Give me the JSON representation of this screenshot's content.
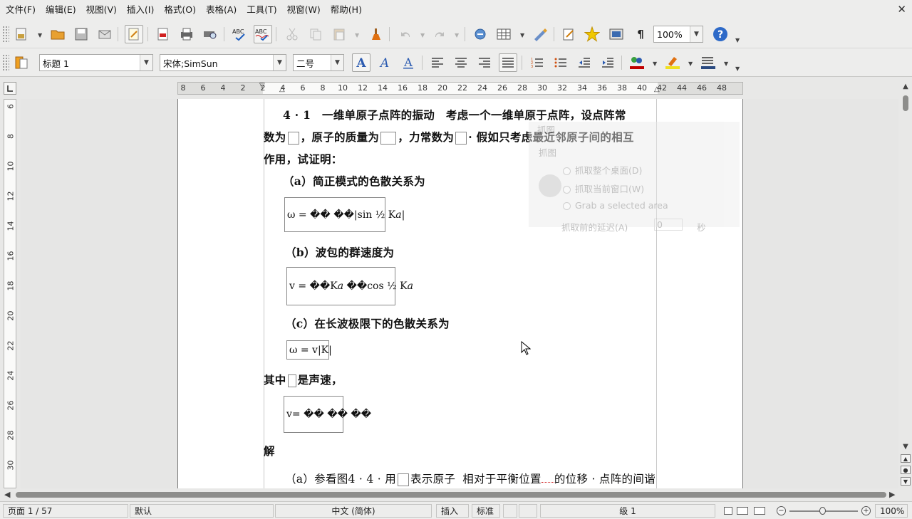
{
  "menubar": {
    "items": [
      "文件(F)",
      "编辑(E)",
      "视图(V)",
      "插入(I)",
      "格式(O)",
      "表格(A)",
      "工具(T)",
      "视窗(W)",
      "帮助(H)"
    ],
    "close_glyph": "✕"
  },
  "toolbar_standard": {
    "zoom_value": "100%",
    "formatting_marks_glyph": "¶",
    "help_glyph": "?"
  },
  "toolbar_format": {
    "paragraph_style": "标题 1",
    "font_name": "宋体;SimSun",
    "font_size": "二号"
  },
  "ruler": {
    "horizontal_ticks": [
      "8",
      "6",
      "4",
      "2",
      "2",
      "4",
      "6",
      "8",
      "10",
      "12",
      "14",
      "16",
      "18",
      "20",
      "22",
      "24",
      "26",
      "28",
      "30",
      "32",
      "34",
      "36",
      "38",
      "40",
      "42",
      "44",
      "46",
      "48"
    ],
    "vertical_ticks": [
      "6",
      "8",
      "10",
      "12",
      "14",
      "16",
      "18",
      "20",
      "22",
      "24",
      "26",
      "28",
      "30"
    ]
  },
  "document": {
    "lines": [
      "4 · 1　一维单原子点阵的振动　考虑一个一维单原于点阵，设点阵常",
      "数为",
      "，原子的质量为",
      "，力常数为",
      "· 假如只考虑最近邻原子间的相互",
      "作用，试证明：",
      "（a）简正模式的色散关系为",
      "（b）波包的群速度为",
      "（c）在长波极限下的色散关系为",
      "其中",
      "是声速，",
      "解",
      "（a）参看图4 · 4 · 用",
      "表示原子",
      "相对于平衡位置",
      "的位移 · 点阵的间谐"
    ],
    "formulas": {
      "a": "ω = �� ��|sin ½ K𝑎|",
      "b": "v = ��K𝑎 ��cos ½ K𝑎",
      "c": "ω = v|K|",
      "d": "v= �� �� ��"
    }
  },
  "grab_dialog_ghost": {
    "title": "抓图",
    "section": "抓图",
    "options": [
      "抓取整个桌面(D)",
      "抓取当前窗口(W)",
      "Grab a selected area"
    ],
    "delay_label": "抓取前的延迟(A)",
    "delay_value": "0",
    "unit": "秒"
  },
  "statusbar": {
    "page": "页面 1 / 57",
    "page_style": "默认",
    "language": "中文 (简体)",
    "insert_mode": "插入",
    "selection_mode": "标准",
    "outline_level": "级 1",
    "zoom_percent": "100%"
  },
  "colors": {
    "chrome": "#ededec",
    "page": "#ffffff",
    "doc_background": "#e6e6e5",
    "scroll_thumb": "#8d8d8b"
  }
}
